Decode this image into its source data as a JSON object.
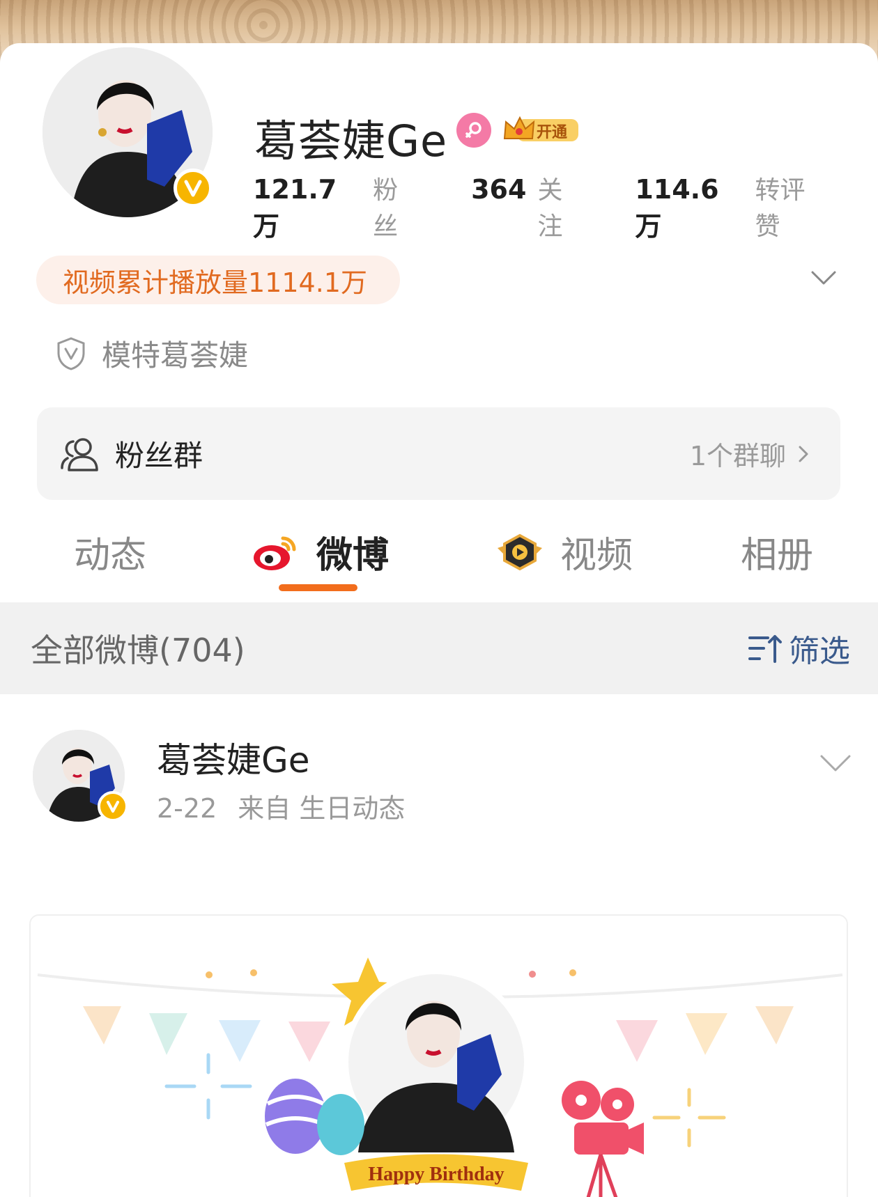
{
  "profile": {
    "name": "葛荟婕Ge",
    "vip_label": "开通",
    "stats": [
      {
        "num": "121.7万",
        "label": "粉丝"
      },
      {
        "num": "364",
        "label": "关注"
      },
      {
        "num": "114.6万",
        "label": "转评赞"
      }
    ],
    "video_plays": "视频累计播放量1114.1万",
    "certification": "模特葛荟婕",
    "verified_icon": "v-badge-icon",
    "gender_icon": "female-icon"
  },
  "fan_group": {
    "label": "粉丝群",
    "count": "1个群聊"
  },
  "tabs": [
    {
      "label": "动态",
      "active": false
    },
    {
      "label": "微博",
      "active": true
    },
    {
      "label": "视频",
      "active": false
    },
    {
      "label": "相册",
      "active": false
    }
  ],
  "filter": {
    "title": "全部微博(704)",
    "button": "筛选"
  },
  "post": {
    "author": "葛荟婕Ge",
    "date": "2-22",
    "source": "来自 生日动态",
    "card_caption": "Happy Birthday"
  },
  "colors": {
    "accent": "#f26d1c",
    "verified": "#f7b500",
    "play_text": "#e16a20",
    "filter_blue": "#3a5a8c"
  }
}
